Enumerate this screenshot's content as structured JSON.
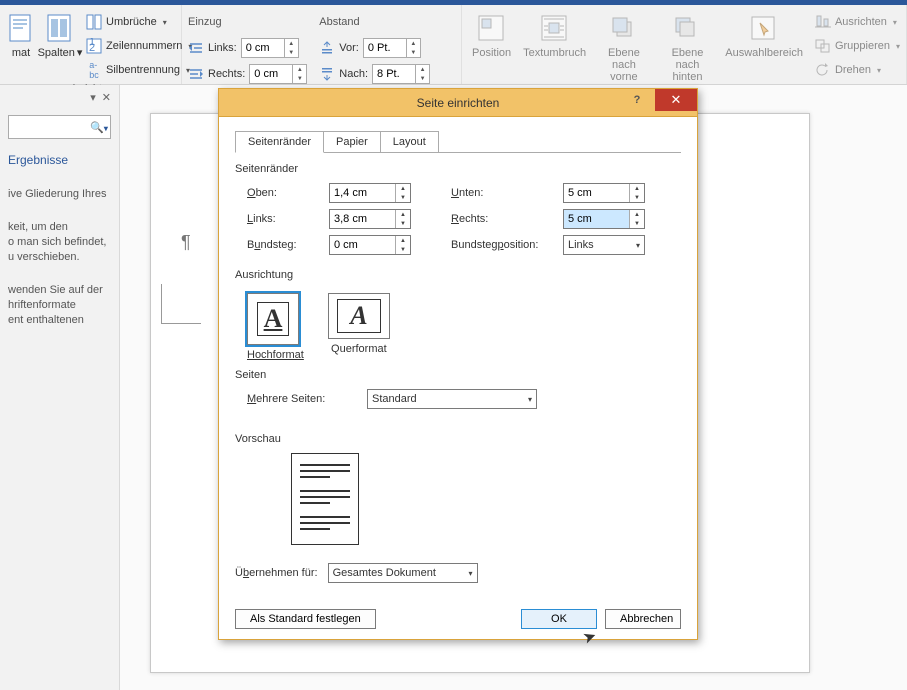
{
  "ribbon": {
    "group1_label": "einrichten",
    "breaks": "Umbrüche",
    "linenums": "Zeilennummern",
    "hyphen": "Silbentrennung",
    "columns": "Spalten",
    "mat": "mat"
  },
  "indent": {
    "group_label_left": "Einzug",
    "group_label_right": "Abstand",
    "left_label": "Links:",
    "right_label": "Rechts:",
    "before_label": "Vor:",
    "after_label": "Nach:",
    "left": "0 cm",
    "right": "0 cm",
    "before": "0 Pt.",
    "after": "8 Pt."
  },
  "arrange": {
    "position": "Position",
    "wrap": "Textumbruch",
    "forward": "Ebene nach\nvorne",
    "backward": "Ebene nach\nhinten",
    "selection": "Auswahlbereich",
    "align": "Ausrichten",
    "group": "Gruppieren",
    "rotate": "Drehen"
  },
  "nav": {
    "tab": "Ergebnisse",
    "body1": "ive Gliederung Ihres",
    "body2": "keit, um den\no man sich befindet,\nu verschieben.",
    "body3": "wenden Sie auf der\nhriftenformate\nent enthaltenen"
  },
  "dialog": {
    "title": "Seite einrichten",
    "tab_margins": "Seitenränder",
    "tab_paper": "Papier",
    "tab_layout": "Layout",
    "section_margins": "Seitenränder",
    "top": "Oben:",
    "bottom": "Unten:",
    "left": "Links:",
    "right": "Rechts:",
    "gutter": "Bundsteg:",
    "gutter_pos": "Bundstegposition:",
    "v_top": "1,4 cm",
    "v_bottom": "5 cm",
    "v_left": "3,8 cm",
    "v_right": "5 cm",
    "v_gutter": "0 cm",
    "v_gutter_pos": "Links",
    "section_orient": "Ausrichtung",
    "portrait": "Hochformat",
    "landscape": "Querformat",
    "section_pages": "Seiten",
    "multi_label": "Mehrere Seiten:",
    "multi_val": "Standard",
    "section_preview": "Vorschau",
    "apply_label": "Übernehmen für:",
    "apply_val": "Gesamtes Dokument",
    "set_default": "Als Standard festlegen",
    "ok": "OK",
    "cancel": "Abbrechen"
  }
}
